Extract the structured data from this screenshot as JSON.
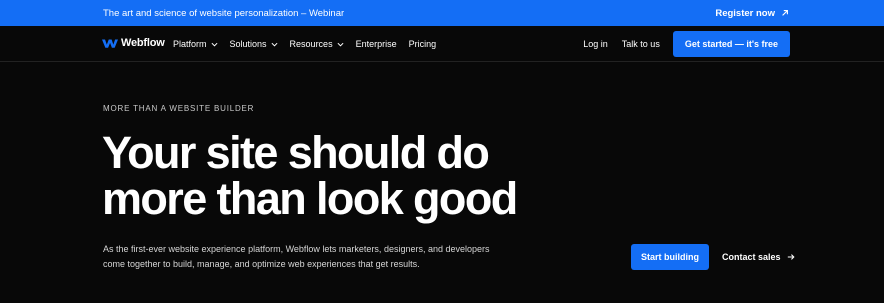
{
  "banner": {
    "text": "The art and science of website personalization – Webinar",
    "link_label": "Register now"
  },
  "nav": {
    "brand": "Webflow",
    "items": [
      {
        "label": "Platform",
        "has_menu": true
      },
      {
        "label": "Solutions",
        "has_menu": true
      },
      {
        "label": "Resources",
        "has_menu": true
      },
      {
        "label": "Enterprise",
        "has_menu": false
      },
      {
        "label": "Pricing",
        "has_menu": false
      }
    ],
    "login_label": "Log in",
    "talk_label": "Talk to us",
    "cta_label": "Get started — it's free"
  },
  "hero": {
    "eyebrow": "MORE THAN A WEBSITE BUILDER",
    "headline_line1": "Your site should do",
    "headline_line2": "more than look good",
    "subtext": "As the first-ever website experience platform, Webflow lets marketers, designers, and developers come together to build, manage, and optimize web experiences that get results.",
    "primary_button": "Start building",
    "secondary_button": "Contact sales"
  },
  "colors": {
    "accent": "#146ef5",
    "background": "#080808"
  }
}
